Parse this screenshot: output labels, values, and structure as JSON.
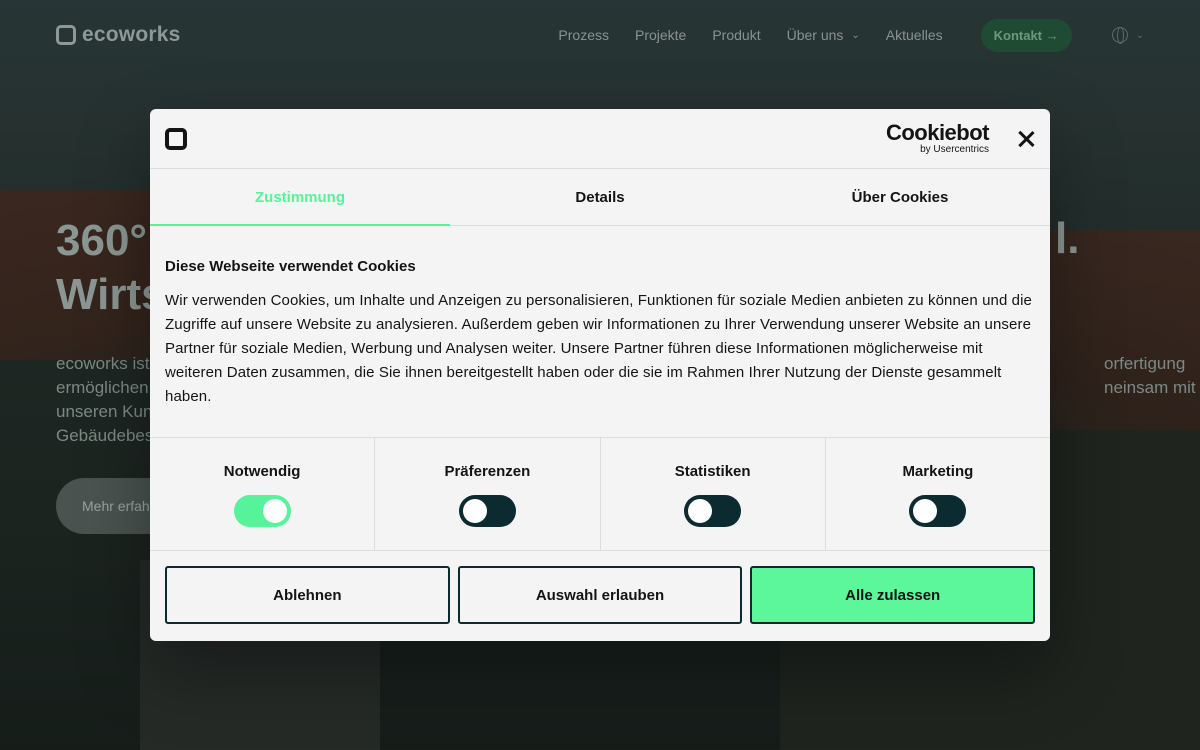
{
  "header": {
    "logo_text": "ecoworks",
    "nav": [
      "Prozess",
      "Projekte",
      "Produkt",
      "Über uns",
      "Aktuelles"
    ],
    "contact_label": "Kontakt →",
    "language_icon": "globe-icon"
  },
  "hero": {
    "title_line1": "360°",
    "title_line1_end": "l.",
    "title_line2": "Wirts",
    "para_lines": [
      "ecoworks ist",
      "ermöglichen",
      "unseren Kun",
      "Gebäudebes"
    ],
    "para_right": [
      "orfertigung",
      "neinsam mit"
    ],
    "more_button": "Mehr erfah"
  },
  "modal": {
    "brand_name": "Cookiebot",
    "brand_sub": "by Usercentrics",
    "tabs": [
      "Zustimmung",
      "Details",
      "Über Cookies"
    ],
    "active_tab": "Zustimmung",
    "heading": "Diese Webseite verwendet Cookies",
    "body": "Wir verwenden Cookies, um Inhalte und Anzeigen zu personalisieren, Funktionen für soziale Medien anbieten zu können und die Zugriffe auf unsere Website zu analysieren. Außerdem geben wir Informationen zu Ihrer Verwendung unserer Website an unsere Partner für soziale Medien, Werbung und Analysen weiter. Unsere Partner führen diese Informationen möglicherweise mit weiteren Daten zusammen, die Sie ihnen bereitgestellt haben oder die sie im Rahmen Ihrer Nutzung der Dienste gesammelt haben.",
    "toggles": [
      {
        "label": "Notwendig",
        "on": true
      },
      {
        "label": "Präferenzen",
        "on": false
      },
      {
        "label": "Statistiken",
        "on": false
      },
      {
        "label": "Marketing",
        "on": false
      }
    ],
    "buttons": {
      "decline": "Ablehnen",
      "allow_selection": "Auswahl erlauben",
      "allow_all": "Alle zulassen"
    }
  },
  "colors": {
    "accent_green": "#56f39a",
    "dark_teal": "#0b2b30"
  }
}
